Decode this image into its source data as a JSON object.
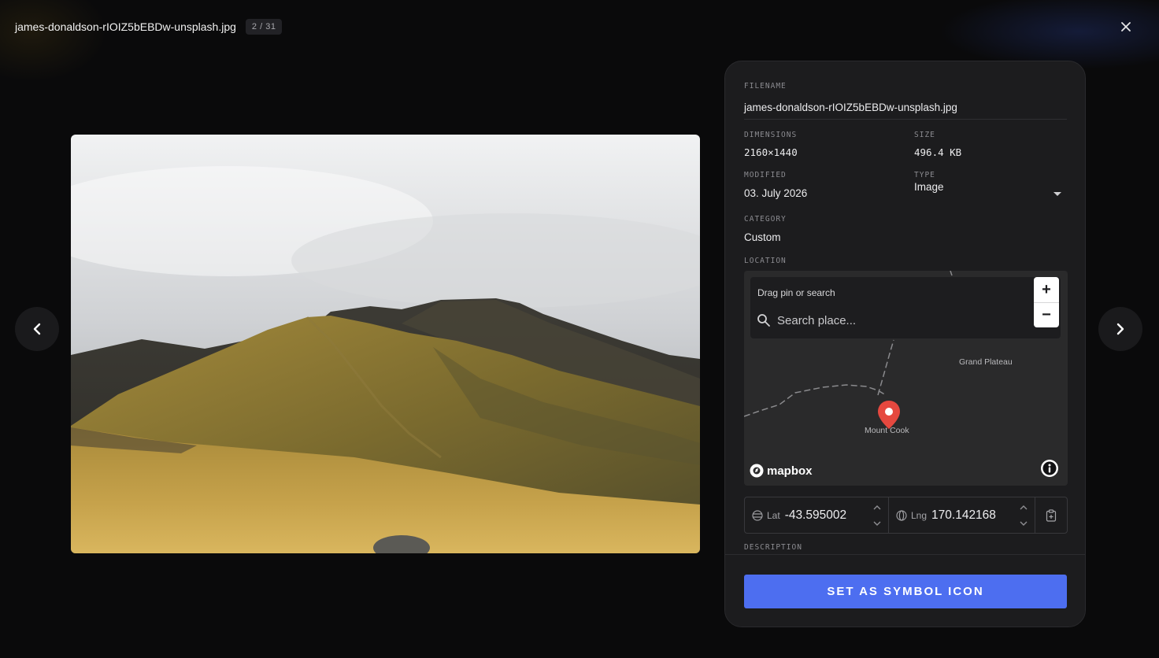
{
  "viewer": {
    "file_title": "james-donaldson-rIOIZ5bEBDw-unsplash.jpg",
    "counter": "2 / 31"
  },
  "details": {
    "filename_label": "FILENAME",
    "filename_value": "james-donaldson-rIOIZ5bEBDw-unsplash.jpg",
    "dimensions_label": "DIMENSIONS",
    "dimensions_value": "2160×1440",
    "size_label": "SIZE",
    "size_value": "496.4 KB",
    "modified_label": "MODIFIED",
    "modified_value": "03. July 2026",
    "type_label": "TYPE",
    "type_value": "Image",
    "category_label": "CATEGORY",
    "category_value": "Custom",
    "location_label": "LOCATION",
    "description_label": "DESCRIPTION"
  },
  "map": {
    "hint": "Drag pin or search",
    "search_placeholder": "Search place...",
    "zoom_in": "+",
    "zoom_out": "−",
    "place_labels": [
      "Grand Plateau",
      "Mount Cook"
    ],
    "attribution": "mapbox"
  },
  "coordinates": {
    "lat_label": "Lat",
    "lat_value": "-43.595002",
    "lng_label": "Lng",
    "lng_value": "170.142168"
  },
  "actions": {
    "set_symbol_label": "SET AS SYMBOL ICON"
  },
  "icons": {
    "close": "close-icon",
    "prev": "chevron-left-icon",
    "next": "chevron-right-icon",
    "search": "search-icon",
    "pin": "map-pin-icon",
    "info": "info-icon",
    "latitude": "latitude-icon",
    "longitude": "globe-icon",
    "paste": "clipboard-icon",
    "dropdown": "caret-down-icon"
  },
  "colors": {
    "accent": "#4d6ef0",
    "pin": "#e5483f",
    "panel": "#1c1c1e"
  }
}
